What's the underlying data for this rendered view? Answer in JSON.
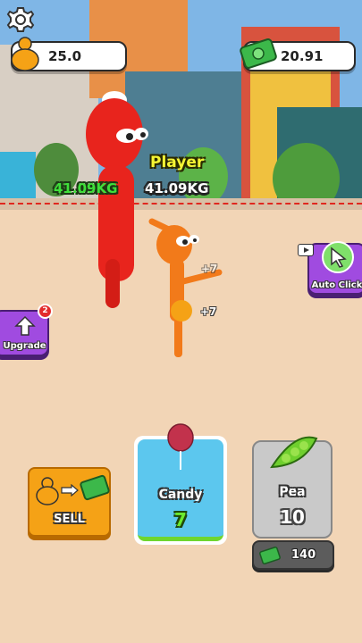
{
  "hud": {
    "weight_value": "25.0",
    "cash_value": "20.91"
  },
  "characters": {
    "rival_weight": "41.09KG",
    "player_name": "Player",
    "player_weight": "41.09KG",
    "gain_popups": [
      "+7",
      "+7"
    ]
  },
  "side_buttons": {
    "upgrade": {
      "label": "Upgrade",
      "badge": "2"
    },
    "auto_click": {
      "label": "Auto Click"
    }
  },
  "actions": {
    "sell_label": "SELL"
  },
  "food_cards": [
    {
      "name": "Candy",
      "value": "7",
      "selected": true
    },
    {
      "name": "Pea",
      "value": "10",
      "selected": false,
      "price": "140"
    }
  ],
  "colors": {
    "rival": "#e8241d",
    "player": "#f27a1a",
    "upgrade_button": "#a04be0",
    "sell_button": "#f5a216",
    "candy_card": "#5cc7ee",
    "pea_card": "#c9c9c9"
  }
}
